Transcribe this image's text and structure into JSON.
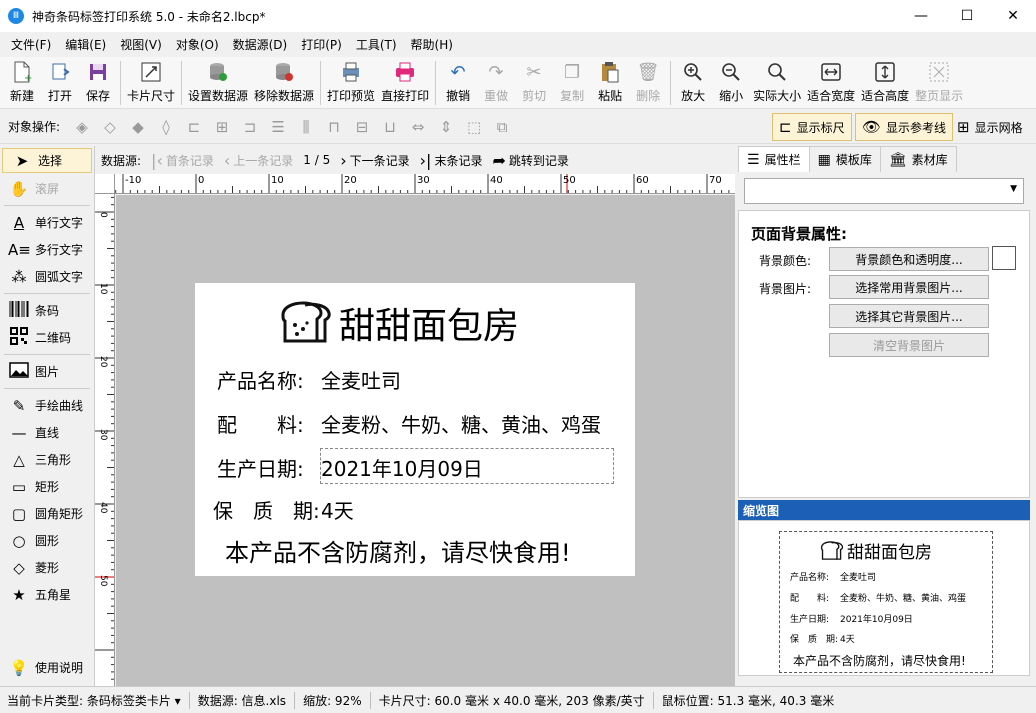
{
  "window": {
    "title": "神奇条码标签打印系统 5.0 - 未命名2.lbcp*",
    "minimize": "—",
    "maximize": "☐",
    "close": "✕"
  },
  "menu": [
    "文件(F)",
    "编辑(E)",
    "视图(V)",
    "对象(O)",
    "数据源(D)",
    "打印(P)",
    "工具(T)",
    "帮助(H)"
  ],
  "toolbar": {
    "new": "新建",
    "open": "打开",
    "save": "保存",
    "card_size": "卡片尺寸",
    "set_datasource": "设置数据源",
    "remove_datasource": "移除数据源",
    "print_preview": "打印预览",
    "direct_print": "直接打印",
    "undo": "撤销",
    "redo": "重做",
    "cut": "剪切",
    "copy": "复制",
    "paste": "粘贴",
    "delete": "删除",
    "zoom_in": "放大",
    "zoom_out": "缩小",
    "actual_size": "实际大小",
    "fit_width": "适合宽度",
    "fit_height": "适合高度",
    "fit_page": "整页显示"
  },
  "objbar": {
    "label": "对象操作:",
    "show_ruler": "显示标尺",
    "show_guides": "显示参考线",
    "show_grid": "显示网格"
  },
  "tools": {
    "select": "选择",
    "scroll": "滚屏",
    "single_text": "单行文字",
    "multi_text": "多行文字",
    "arc_text": "圆弧文字",
    "barcode": "条码",
    "qrcode": "二维码",
    "image": "图片",
    "freehand": "手绘曲线",
    "line": "直线",
    "triangle": "三角形",
    "rect": "矩形",
    "round_rect": "圆角矩形",
    "circle": "圆形",
    "diamond": "菱形",
    "star": "五角星",
    "help": "使用说明"
  },
  "records": {
    "label": "数据源:",
    "first": "首条记录",
    "prev": "上一条记录",
    "position": "1 / 5",
    "next": "下一条记录",
    "last": "末条记录",
    "jump": "跳转到记录"
  },
  "ruler": {
    "top_ticks": [
      "-10",
      "0",
      "10",
      "20",
      "30",
      "40",
      "50",
      "60",
      "70"
    ],
    "left_ticks": [
      "0",
      "10",
      "20",
      "30",
      "40",
      "50"
    ]
  },
  "card": {
    "title": "甜甜面包房",
    "name_label": "产品名称:",
    "name_value": "全麦吐司",
    "ingredients_label": "配　　料:",
    "ingredients_value": "全麦粉、牛奶、糖、黄油、鸡蛋",
    "date_label": "生产日期:",
    "date_value": "2021年10月09日",
    "shelf_label": "保　质　期:",
    "shelf_value": "4天",
    "slogan": "本产品不含防腐剂，请尽快食用!"
  },
  "right": {
    "tab_props": "属性栏",
    "tab_templates": "模板库",
    "tab_assets": "素材库",
    "heading": "页面背景属性:",
    "bg_color_label": "背景颜色:",
    "bg_color_btn": "背景颜色和透明度...",
    "bg_image_label": "背景图片:",
    "bg_common_btn": "选择常用背景图片...",
    "bg_other_btn": "选择其它背景图片...",
    "bg_clear_btn": "清空背景图片",
    "preview_title": "缩览图"
  },
  "preview": {
    "ingredients_value": "全麦粉、牛奶、糖、黄油、鸡蛋"
  },
  "status": {
    "card_type": "当前卡片类型:  条码标签类卡片 ▾",
    "datasource": "数据源:  信息.xls",
    "zoom": "缩放:  92%",
    "card_size": "卡片尺寸:  60.0 毫米 x 40.0 毫米, 203 像素/英寸",
    "mouse": "鼠标位置:  51.3 毫米,  40.3 毫米"
  },
  "colors": {
    "accent_blue": "#1c5fb6",
    "canvas_gray": "#c0c0c0",
    "active_toggle": "#fdf3d7"
  }
}
